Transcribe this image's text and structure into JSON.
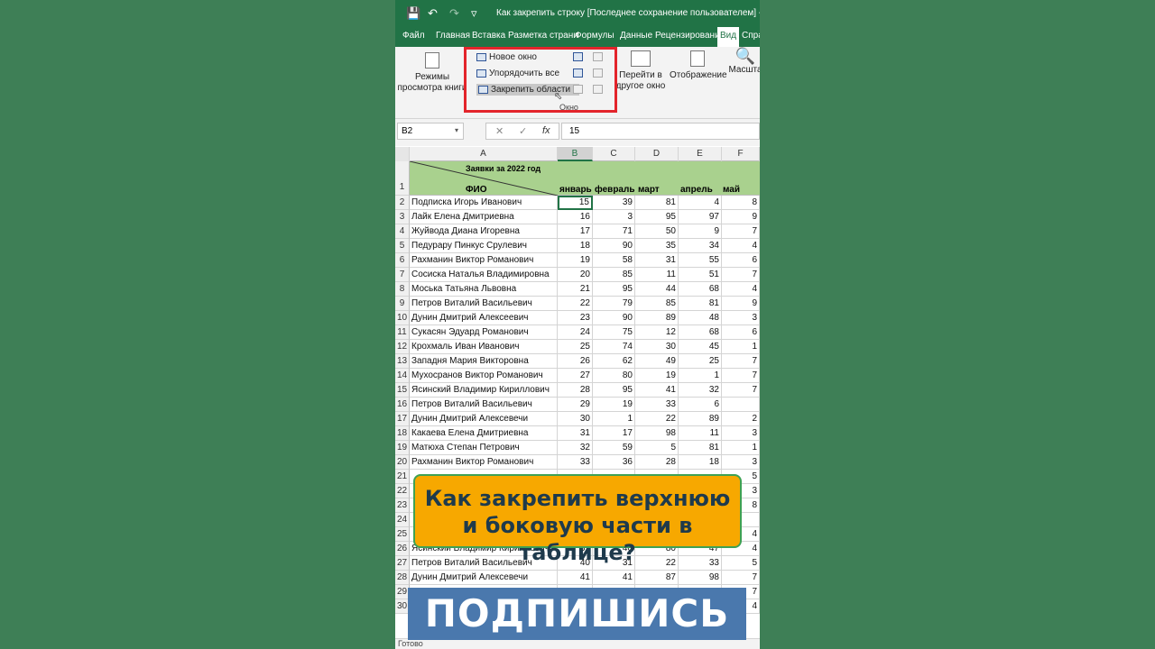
{
  "titlebar": {
    "save_icon": "save-icon",
    "undo_icon": "undo-icon",
    "redo_icon": "redo-icon",
    "title": "Как закрепить строку [Последнее сохранение пользователем] - Е..."
  },
  "tabs": [
    "Файл",
    "Главная",
    "Вставка",
    "Разметка страни",
    "Формулы",
    "Данные",
    "Рецензировани",
    "Вид",
    "Спра"
  ],
  "active_tab": "Вид",
  "ribbon": {
    "views_label": "Режимы просмотра книги",
    "new_window": "Новое окно",
    "arrange_all": "Упорядочить все",
    "freeze_panes": "Закрепить области",
    "window_group": "Окно",
    "switch_windows": "Перейти в другое окно",
    "show": "Отображение",
    "zoom": "Масшта"
  },
  "formula_bar": {
    "name_box": "B2",
    "value": "15",
    "fx": "fx"
  },
  "columns": [
    "A",
    "B",
    "C",
    "D",
    "E",
    "F"
  ],
  "header": {
    "title": "Заявки за 2022 год",
    "fio": "ФИО",
    "months": [
      "январь",
      "февраль",
      "март",
      "апрель",
      "май"
    ]
  },
  "rows": [
    {
      "n": "2",
      "name": "Подписка Игорь Иванович",
      "v": [
        "15",
        "39",
        "81",
        "4",
        "8"
      ]
    },
    {
      "n": "3",
      "name": "Лайк Елена Дмитриевна",
      "v": [
        "16",
        "3",
        "95",
        "97",
        "9"
      ]
    },
    {
      "n": "4",
      "name": "Жуйвода Диана Игоревна",
      "v": [
        "17",
        "71",
        "50",
        "9",
        "7"
      ]
    },
    {
      "n": "5",
      "name": "Педурару Пинкус Срулевич",
      "v": [
        "18",
        "90",
        "35",
        "34",
        "4"
      ]
    },
    {
      "n": "6",
      "name": "Рахманин Виктор Романович",
      "v": [
        "19",
        "58",
        "31",
        "55",
        "6"
      ]
    },
    {
      "n": "7",
      "name": "Сосиска Наталья Владимировна",
      "v": [
        "20",
        "85",
        "11",
        "51",
        "7"
      ]
    },
    {
      "n": "8",
      "name": "Моська Татьяна Львовна",
      "v": [
        "21",
        "95",
        "44",
        "68",
        "4"
      ]
    },
    {
      "n": "9",
      "name": "Петров Виталий Васильевич",
      "v": [
        "22",
        "79",
        "85",
        "81",
        "9"
      ]
    },
    {
      "n": "10",
      "name": "Дунин Дмитрий Алексеевич",
      "v": [
        "23",
        "90",
        "89",
        "48",
        "3"
      ]
    },
    {
      "n": "11",
      "name": "Сукасян Эдуард Романович",
      "v": [
        "24",
        "75",
        "12",
        "68",
        "6"
      ]
    },
    {
      "n": "12",
      "name": "Крохмаль Иван Иванович",
      "v": [
        "25",
        "74",
        "30",
        "45",
        "1"
      ]
    },
    {
      "n": "13",
      "name": "Западня Мария Викторовна",
      "v": [
        "26",
        "62",
        "49",
        "25",
        "7"
      ]
    },
    {
      "n": "14",
      "name": "Мухосранов Виктор Романович",
      "v": [
        "27",
        "80",
        "19",
        "1",
        "7"
      ]
    },
    {
      "n": "15",
      "name": "Ясинский Владимир Кириллович",
      "v": [
        "28",
        "95",
        "41",
        "32",
        "7"
      ]
    },
    {
      "n": "16",
      "name": "Петров Виталий Васильевич",
      "v": [
        "29",
        "19",
        "33",
        "6",
        ""
      ]
    },
    {
      "n": "17",
      "name": "Дунин Дмитрий Алексевечи",
      "v": [
        "30",
        "1",
        "22",
        "89",
        "2"
      ]
    },
    {
      "n": "18",
      "name": "Какаева Елена Дмитриевна",
      "v": [
        "31",
        "17",
        "98",
        "11",
        "3"
      ]
    },
    {
      "n": "19",
      "name": "Матюха Степан Петрович",
      "v": [
        "32",
        "59",
        "5",
        "81",
        "1"
      ]
    },
    {
      "n": "20",
      "name": "Рахманин Виктор Романович",
      "v": [
        "33",
        "36",
        "28",
        "18",
        "3"
      ]
    },
    {
      "n": "21",
      "name": "",
      "v": [
        "",
        "",
        "",
        "",
        "5"
      ]
    },
    {
      "n": "22",
      "name": "",
      "v": [
        "",
        "",
        "",
        "",
        "3"
      ]
    },
    {
      "n": "23",
      "name": "",
      "v": [
        "",
        "",
        "",
        "",
        "8"
      ]
    },
    {
      "n": "24",
      "name": "",
      "v": [
        "",
        "",
        "",
        "",
        ""
      ]
    },
    {
      "n": "25",
      "name": "",
      "v": [
        "",
        "",
        "",
        "",
        "4"
      ]
    },
    {
      "n": "26",
      "name": "Ясинский Владимир Кириллович",
      "v": [
        "39",
        "40",
        "80",
        "47",
        "4"
      ]
    },
    {
      "n": "27",
      "name": "Петров Виталий Васильевич",
      "v": [
        "40",
        "31",
        "22",
        "33",
        "5"
      ]
    },
    {
      "n": "28",
      "name": "Дунин Дмитрий Алексевечи",
      "v": [
        "41",
        "41",
        "87",
        "98",
        "7"
      ]
    },
    {
      "n": "29",
      "name": "",
      "v": [
        "",
        "",
        "",
        "",
        "7"
      ]
    },
    {
      "n": "30",
      "name": "",
      "v": [
        "",
        "",
        "",
        "",
        "4"
      ]
    }
  ],
  "status": "Готово",
  "overlay": {
    "question": "Как закрепить верхнюю и боковую части в таблице?",
    "subscribe": "ПОДПИШИСЬ"
  },
  "colors": {
    "excel_green": "#217346",
    "header_fill": "#a9d18e",
    "highlight_red": "#e3242b",
    "bubble_fill": "#f7a800",
    "subscribe_fill": "#4a78ad",
    "background": "#3e7f56"
  }
}
